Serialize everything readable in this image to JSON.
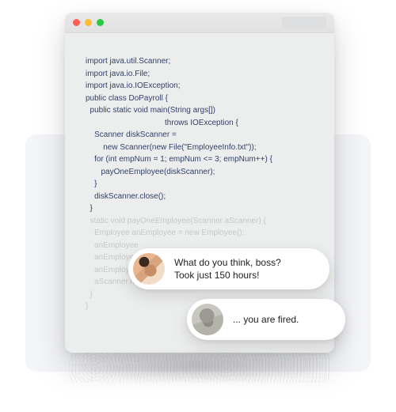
{
  "code": {
    "lines": [
      "import java.util.Scanner;",
      "import java.io.File;",
      "import java.io.IOException;",
      "public class DoPayroll {",
      "  public static void main(String args[])",
      "                                    throws IOException {",
      "    Scanner diskScanner =",
      "        new Scanner(new File(\"EmployeeInfo.txt\"));",
      "    for (int empNum = 1; empNum <= 3; empNum++) {",
      "       payOneEmployee(diskScanner);",
      "    }",
      "    diskScanner.close();",
      "  }"
    ],
    "faded_lines": [
      "  static void payOneEmployee(Scanner aScanner) {",
      "    Employee anEmployee = new Employee();",
      "    anEmployee",
      "    anEmployee",
      "    anEmployee",
      "    aScanner.ne",
      "  }",
      "}"
    ]
  },
  "chat": {
    "bubble1_line1": "What do you think, boss?",
    "bubble1_line2": "Took just 150 hours!",
    "bubble2": "... you are fired."
  }
}
